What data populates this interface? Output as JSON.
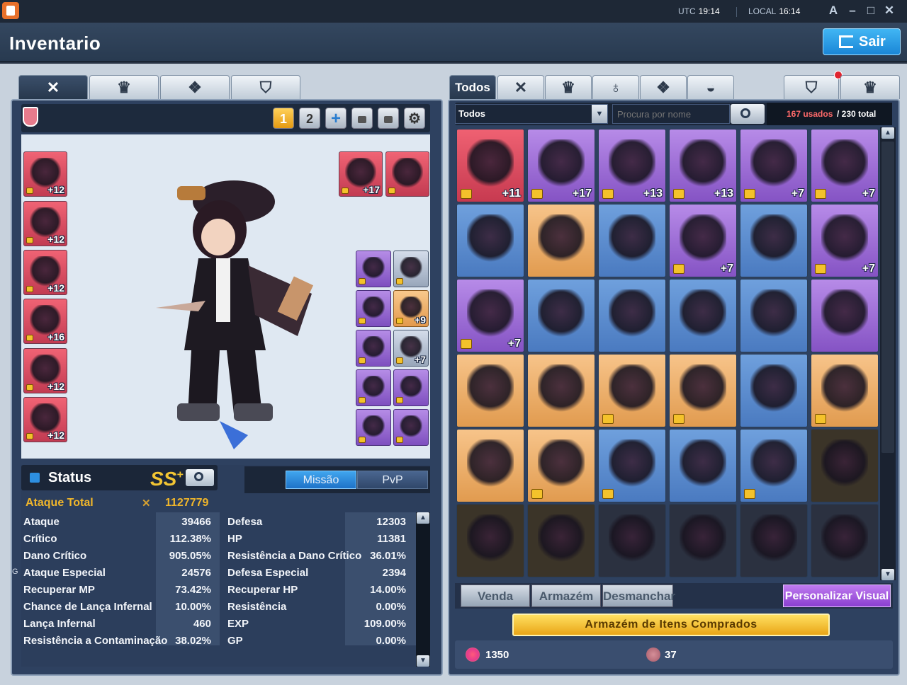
{
  "titlebar": {
    "utc_label": "UTC",
    "utc_time": "19:14",
    "local_label": "LOCAL",
    "local_time": "16:14",
    "btn_a": "A",
    "btn_min": "–",
    "btn_max": "□",
    "btn_close": "✕"
  },
  "header": {
    "title": "Inventario",
    "exit_label": "Sair"
  },
  "left": {
    "slot_buttons": [
      "1",
      "2",
      "+"
    ],
    "equip_left": [
      "+12",
      "+12",
      "+12",
      "+16",
      "+12",
      "+12"
    ],
    "weapon_top": [
      "+17",
      ""
    ],
    "small_right": [
      {
        "level": ""
      },
      {
        "level": ""
      },
      {
        "level": ""
      },
      {
        "level": "+9"
      },
      {
        "level": ""
      },
      {
        "level": "+7"
      },
      {
        "level": ""
      },
      {
        "level": ""
      },
      {
        "level": ""
      },
      {
        "level": ""
      }
    ]
  },
  "status": {
    "title": "Status",
    "rank": "SS",
    "rank_sup": "+",
    "tab_mission": "Missão",
    "tab_pvp": "PvP",
    "total_label": "Ataque Total",
    "total_value": "1127779",
    "left_stats": [
      {
        "label": "Ataque",
        "value": "39466"
      },
      {
        "label": "Crítico",
        "value": "112.38%"
      },
      {
        "label": "Dano Crítico",
        "value": "905.05%"
      },
      {
        "label": "Ataque Especial",
        "value": "24576"
      },
      {
        "label": "Recuperar MP",
        "value": "73.42%"
      },
      {
        "label": "Chance de Lança Infernal",
        "value": "10.00%"
      },
      {
        "label": "Lança Infernal",
        "value": "460"
      },
      {
        "label": "Resistência a Contaminação",
        "value": "38.02%"
      }
    ],
    "right_stats": [
      {
        "label": "Defesa",
        "value": "12303"
      },
      {
        "label": "HP",
        "value": "11381"
      },
      {
        "label": "Resistência a Dano Crítico",
        "value": "36.01%"
      },
      {
        "label": "Defesa Especial",
        "value": "2394"
      },
      {
        "label": "Recuperar HP",
        "value": "14.00%"
      },
      {
        "label": "Resistência",
        "value": "0.00%"
      },
      {
        "label": "EXP",
        "value": "109.00%"
      },
      {
        "label": "GP",
        "value": "0.00%"
      }
    ],
    "side_letter": "G"
  },
  "right": {
    "tab_all": "Todos",
    "filter_value": "Todos",
    "search_placeholder": "Procura por nome",
    "used_count": "167 usados",
    "total_count": "/ 230 total",
    "items": [
      {
        "bg": "r",
        "level": "+11",
        "lock": true
      },
      {
        "bg": "p",
        "level": "+17",
        "lock": true
      },
      {
        "bg": "p",
        "level": "+13",
        "lock": true
      },
      {
        "bg": "p",
        "level": "+13",
        "lock": true
      },
      {
        "bg": "p",
        "level": "+7",
        "lock": true
      },
      {
        "bg": "p",
        "level": "+7",
        "lock": true
      },
      {
        "bg": "b",
        "level": "",
        "lock": false
      },
      {
        "bg": "o",
        "level": "",
        "lock": false
      },
      {
        "bg": "b",
        "level": "",
        "lock": false
      },
      {
        "bg": "p",
        "level": "+7",
        "lock": true
      },
      {
        "bg": "b",
        "level": "",
        "lock": false
      },
      {
        "bg": "p",
        "level": "+7",
        "lock": true
      },
      {
        "bg": "p",
        "level": "+7",
        "lock": true
      },
      {
        "bg": "b",
        "level": "",
        "lock": false
      },
      {
        "bg": "b",
        "level": "",
        "lock": false
      },
      {
        "bg": "b",
        "level": "",
        "lock": false
      },
      {
        "bg": "b",
        "level": "",
        "lock": false
      },
      {
        "bg": "p",
        "level": "",
        "lock": false
      },
      {
        "bg": "o",
        "level": "",
        "lock": false
      },
      {
        "bg": "o",
        "level": "",
        "lock": false
      },
      {
        "bg": "o",
        "level": "",
        "lock": true
      },
      {
        "bg": "o",
        "level": "",
        "lock": true
      },
      {
        "bg": "b",
        "level": "",
        "lock": false
      },
      {
        "bg": "o",
        "level": "",
        "lock": true
      },
      {
        "bg": "o",
        "level": "",
        "lock": false
      },
      {
        "bg": "o",
        "level": "",
        "lock": true
      },
      {
        "bg": "b",
        "level": "",
        "lock": true
      },
      {
        "bg": "b",
        "level": "",
        "lock": false
      },
      {
        "bg": "b",
        "level": "",
        "lock": true
      },
      {
        "bg": "dd",
        "level": "",
        "lock": false
      },
      {
        "bg": "dd",
        "level": "",
        "lock": false
      },
      {
        "bg": "dd",
        "level": "",
        "lock": false
      },
      {
        "bg": "d",
        "level": "",
        "lock": false
      },
      {
        "bg": "d",
        "level": "",
        "lock": false
      },
      {
        "bg": "d",
        "level": "",
        "lock": false
      },
      {
        "bg": "d",
        "level": "",
        "lock": false
      }
    ],
    "btn_sell": "Venda",
    "btn_storage": "Armazém",
    "btn_dismantle": "Desmanchar",
    "btn_custom": "Personalizar Visual",
    "btn_purchased": "Armazém de Itens Comprados",
    "currency1": "1350",
    "currency2": "37"
  }
}
